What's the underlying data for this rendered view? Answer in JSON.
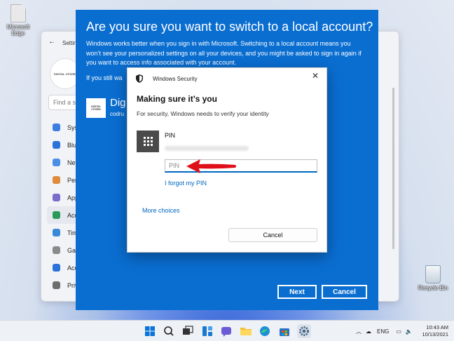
{
  "desktop": {
    "icons": [
      {
        "label": "Microsoft Edge",
        "icon": "edge-shortcut-icon"
      },
      {
        "label": "Recycle Bin",
        "icon": "recycle-bin-icon"
      }
    ]
  },
  "settings": {
    "title": "Settings",
    "avatar_text": "DIGITAL CITIZEN",
    "search_placeholder": "Find a se",
    "nav": [
      {
        "label": "Sys",
        "color": "#3b7de0"
      },
      {
        "label": "Blu",
        "color": "#2a73d8"
      },
      {
        "label": "Net",
        "color": "#4a8fe6"
      },
      {
        "label": "Pers",
        "color": "#e08a3b"
      },
      {
        "label": "App",
        "color": "#7a6ccd"
      },
      {
        "label": "Acc",
        "color": "#2a9a5b"
      },
      {
        "label": "Tim",
        "color": "#3a88d8"
      },
      {
        "label": "Gar",
        "color": "#8a8a8a"
      },
      {
        "label": "Acc",
        "color": "#2a73d8"
      },
      {
        "label": "Priv",
        "color": "#6d6d6d"
      }
    ]
  },
  "local_dialog": {
    "title": "Are you sure you want to switch to a local account?",
    "description": "Windows works better when you sign in with Microsoft. Switching to a local account means you won’t see your personalized settings on all your devices, and you might be asked to sign in again if you want to access info associated with your account.",
    "still_text": "If you still wa",
    "account_logo_text": "DIGITAL CITIZEN",
    "account_name": "Dig",
    "account_email": "codru",
    "next_label": "Next",
    "cancel_label": "Cancel"
  },
  "security_dialog": {
    "app_name": "Windows Security",
    "close_glyph": "✕",
    "title": "Making sure it’s you",
    "subtitle": "For security, Windows needs to verify your identity",
    "pin_label": "PIN",
    "pin_placeholder": "PIN",
    "forgot_label": "I forgot my PIN",
    "more_choices_label": "More choices",
    "cancel_label": "Cancel"
  },
  "taskbar": {
    "apps": [
      "start-icon",
      "search-icon",
      "task-view-icon",
      "widgets-icon",
      "chat-icon",
      "file-explorer-icon",
      "edge-icon",
      "store-icon",
      "settings-icon"
    ],
    "language": "ENG",
    "time": "10:43 AM",
    "date": "10/13/2021"
  }
}
